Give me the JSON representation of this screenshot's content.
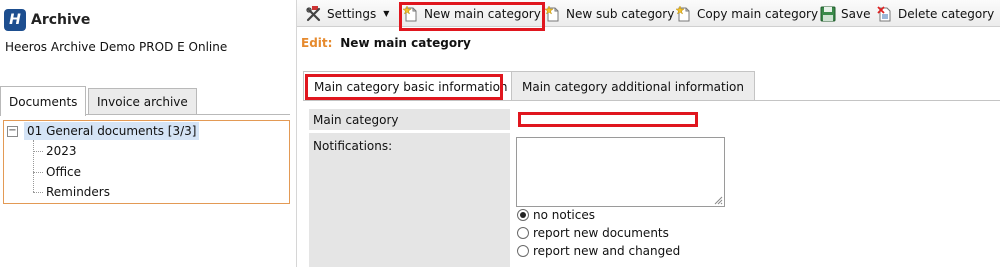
{
  "app": {
    "title": "Archive",
    "logo_letter": "H",
    "organization": "Heeros Archive Demo PROD E Online"
  },
  "left_tabs": [
    {
      "label": "Documents",
      "active": true
    },
    {
      "label": "Invoice archive",
      "active": false
    }
  ],
  "tree": {
    "root": "01 General documents [3/3]",
    "expander": "−",
    "children": [
      "2023",
      "Office",
      "Reminders"
    ]
  },
  "toolbar": {
    "settings": "Settings",
    "settings_arrow": "▼",
    "new_main_category": "New main category",
    "new_sub_category": "New sub category",
    "copy_main_category": "Copy main category",
    "save": "Save",
    "delete_category": "Delete category",
    "icons": [
      "settings-icon",
      "new-main-category-icon",
      "new-sub-category-icon",
      "copy-main-category-icon",
      "save-icon",
      "delete-category-icon"
    ]
  },
  "edit": {
    "prefix": "Edit:",
    "title": "New main category"
  },
  "main_tabs": [
    {
      "label": "Main category basic information",
      "active": true
    },
    {
      "label": "Main category additional information",
      "active": false
    }
  ],
  "form": {
    "main_category_label": "Main category",
    "main_category_value": "",
    "notifications_label": "Notifications:",
    "notifications_value": "",
    "radio_options": [
      {
        "label": "no notices",
        "checked": true
      },
      {
        "label": "report new documents",
        "checked": false
      },
      {
        "label": "report new and changed",
        "checked": false
      }
    ]
  },
  "colors": {
    "accent_red": "#e0161e",
    "logo_blue": "#1d4e8f",
    "edit_orange": "#e68a2e",
    "tree_selection": "#d5e4f6",
    "tree_border": "#e39a55",
    "label_bg": "#e5e5e5"
  }
}
